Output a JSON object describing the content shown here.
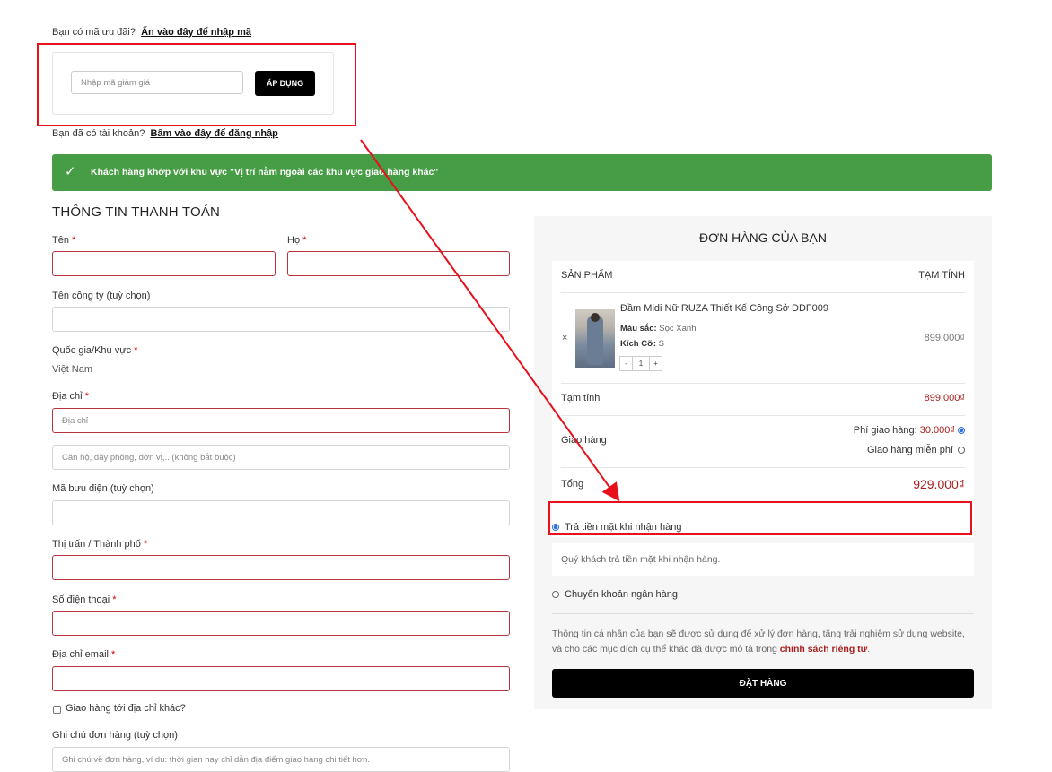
{
  "coupon": {
    "question": "Bạn có mã ưu đãi?",
    "link": "Ấn vào đây để nhập mã",
    "placeholder": "Nhập mã giảm giá",
    "apply_label": "ÁP DỤNG"
  },
  "login": {
    "question": "Bạn đã có tài khoản?",
    "link": "Bấm vào đây để đăng nhập"
  },
  "success_message": "Khách hàng khớp với khu vực \"Vị trí nằm ngoài các khu vực giao hàng khác\"",
  "billing": {
    "title": "THÔNG TIN THANH TOÁN",
    "first_name_label": "Tên",
    "last_name_label": "Họ",
    "company_label": "Tên công ty (tuỳ chọn)",
    "country_label": "Quốc gia/Khu vực",
    "country_value": "Việt Nam",
    "address_label": "Địa chỉ",
    "address_placeholder": "Địa chỉ",
    "address2_placeholder": "Căn hộ, dãy phòng, đơn vị,.. (không bắt buộc)",
    "postcode_label": "Mã bưu điện (tuỳ chọn)",
    "city_label": "Thị trấn / Thành phố",
    "phone_label": "Số điện thoại",
    "email_label": "Địa chỉ email",
    "ship_diff_label": "Giao hàng tới địa chỉ khác?",
    "notes_label": "Ghi chú đơn hàng (tuỳ chọn)",
    "notes_placeholder": "Ghi chú về đơn hàng, ví dụ: thời gian hay chỉ dẫn địa điểm giao hàng chi tiết hơn.",
    "required_mark": "*"
  },
  "order": {
    "title": "ĐƠN HÀNG CỦA BẠN",
    "col_product": "SẢN PHẨM",
    "col_subtotal": "TẠM TÍNH",
    "remove_symbol": "×",
    "product": {
      "name": "Đầm Midi Nữ RUZA Thiết Kế Công Sở DDF009",
      "color_label": "Màu sắc:",
      "color_value": "Sọc Xanh",
      "size_label": "Kích Cỡ:",
      "size_value": "S",
      "qty_minus": "-",
      "qty": "1",
      "qty_plus": "+",
      "price": "899.000₫"
    },
    "subtotal_label": "Tạm tính",
    "subtotal_value": "899.000₫",
    "shipping_label": "Giao hàng",
    "shipping_fee_label": "Phí giao hàng:",
    "shipping_fee_value": "30.000₫",
    "shipping_free_label": "Giao hàng miễn phí",
    "total_label": "Tổng",
    "total_value": "929.000₫"
  },
  "payment": {
    "cod_label": "Trả tiền mặt khi nhận hàng",
    "cod_desc": "Quý khách trả tiền mặt khi nhận hàng.",
    "bank_label": "Chuyển khoản ngân hàng"
  },
  "privacy": {
    "text": "Thông tin cá nhân của bạn sẽ được sử dụng để xử lý đơn hàng, tăng trải nghiệm sử dụng website, và cho các mục đích cụ thể khác đã được mô tả trong",
    "link": "chính sách riêng tư",
    "end": "."
  },
  "place_order_label": "ĐẶT HÀNG",
  "colors": {
    "success_bg": "#479c46",
    "accent_red": "#a81e1e",
    "annotation": "#e8101a",
    "radio_blue": "#2f6fde"
  },
  "icons": {
    "success": "check-icon",
    "remove": "close-icon"
  }
}
